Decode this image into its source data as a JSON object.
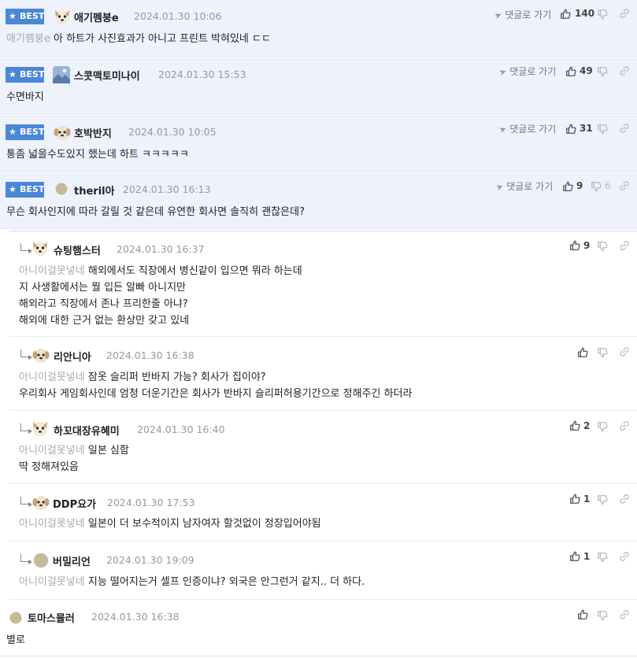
{
  "best_label": "BEST",
  "goto_label": "댓글로 가기",
  "comments": [
    {
      "nick": "애기펨붕e",
      "time": "2024.01.30 10:06",
      "likes": "140",
      "dislikes": "",
      "mention": "애기펨붕e",
      "text": "아 하트가 사진효과가 아니고 프린트 박혀있네 ㄷㄷ"
    },
    {
      "nick": "스콧맥토미나이",
      "time": "2024.01.30 15:53",
      "likes": "49",
      "dislikes": "",
      "text": "수면바지"
    },
    {
      "nick": "호박반지",
      "time": "2024.01.30 10:05",
      "likes": "31",
      "dislikes": "",
      "text": "통좀 넓을수도있지 했는데 하트 ㅋㅋㅋㅋㅋ"
    },
    {
      "nick": "theril아",
      "time": "2024.01.30 16:13",
      "likes": "9",
      "dislikes": "6",
      "text": "무슨 회사인지에 따라 갈릴 것 같은데 유연한 회사면 솔직히 괜찮은데?"
    }
  ],
  "replies": [
    {
      "nick": "슈팅햄스터",
      "time": "2024.01.30 16:37",
      "likes": "9",
      "mention": "아니이걸못넣네",
      "lines": [
        "해외에서도 직장에서 병신같이 입으면 뭐라 하는데",
        "지 사생활에서는 뭘 입든 알빠 아니지만",
        "해외라고 직장에서 존나 프리한줄 아냐?",
        "해외에 대한 근거 없는 환상만 갖고 있네"
      ]
    },
    {
      "nick": "리안니아",
      "time": "2024.01.30 16:38",
      "likes": "",
      "mention": "아니이걸못넣네",
      "lines": [
        "잠옷 슬리퍼 반바지 가능? 회사가 집이야?",
        "우리회사 게임회사인데 엄청 더운기간은 회사가 반바지 슬리퍼허용기간으로 정해주긴 하더라"
      ]
    },
    {
      "nick": "하꼬대장유혜미",
      "time": "2024.01.30 16:40",
      "likes": "2",
      "mention": "아니이걸못넣네",
      "lines": [
        "일본 심함",
        "딱 정해져있음"
      ]
    },
    {
      "nick": "DDP요가",
      "time": "2024.01.30 17:53",
      "likes": "1",
      "mention": "아니이걸못넣네",
      "lines": [
        "일본이 더 보수적이지 남자여자 할것없이 정장입어야됨"
      ]
    },
    {
      "nick": "버밀리언",
      "time": "2024.01.30 19:09",
      "likes": "1",
      "mention": "아니이걸못넣네",
      "lines": [
        "지능 떨어지는거 셀프 인증이냐? 외국은 안그런거 같지.. 더 하다."
      ]
    }
  ],
  "last_comment": {
    "nick": "토마스뮬러",
    "time": "2024.01.30 16:38",
    "likes": "",
    "text": "별로"
  }
}
